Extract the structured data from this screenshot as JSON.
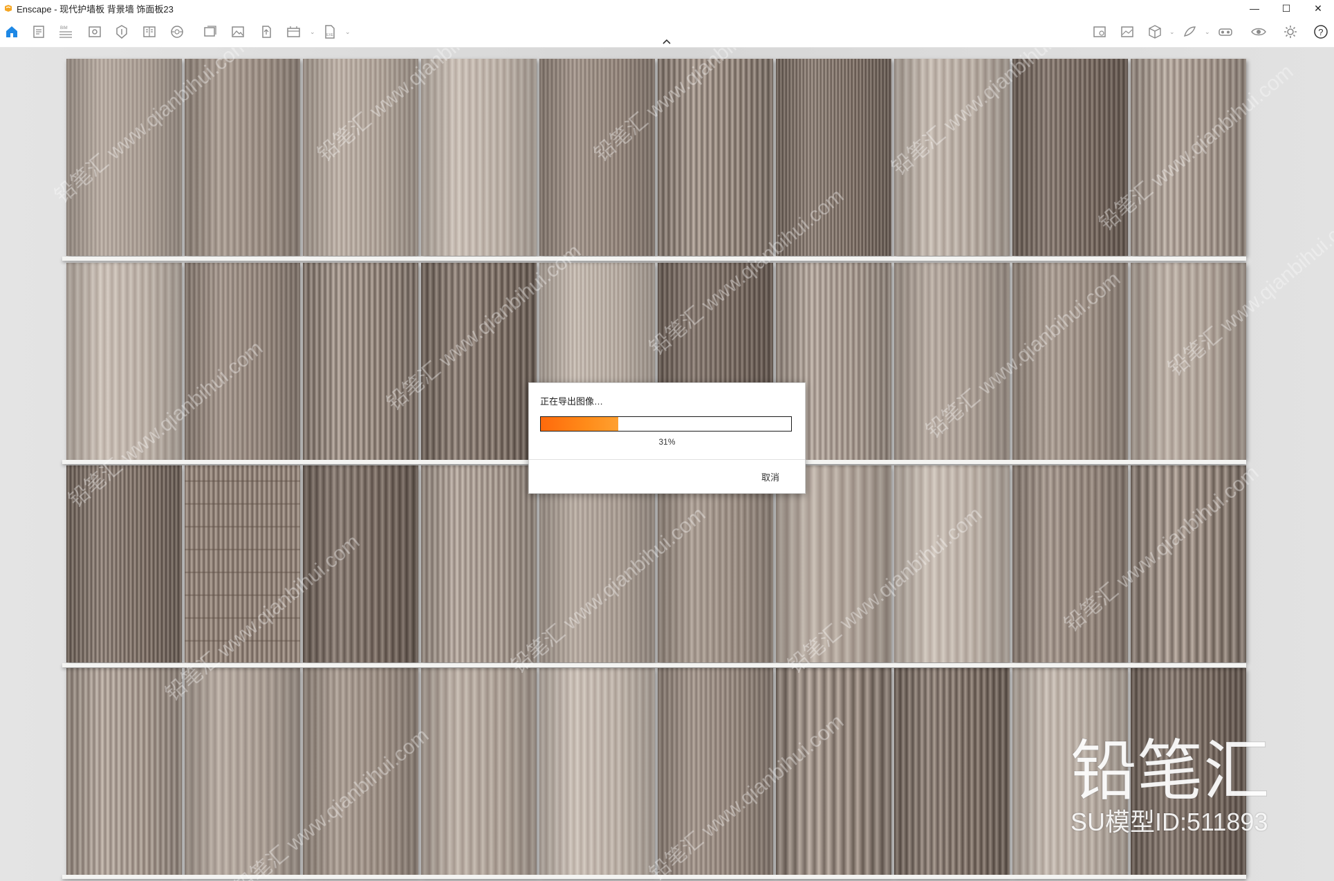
{
  "window": {
    "title": "Enscape - 现代护墙板 背景墙 饰面板23",
    "controls": {
      "minimize": "—",
      "maximize": "☐",
      "close": "✕"
    }
  },
  "toolbar": {
    "left_icons": [
      "home-icon",
      "document-icon",
      "bim-icon",
      "views-icon",
      "asset-library-icon",
      "split-view-icon",
      "panorama-icon",
      "batch-render-icon",
      "video-editor-icon",
      "image-icon",
      "upload-icon",
      "render-icon",
      "export-icon"
    ],
    "right_icons": [
      "settings-panel-icon",
      "visual-settings-icon",
      "cube-icon",
      "feedback-icon",
      "vr-icon",
      "eye-icon",
      "gear-icon",
      "help-icon"
    ]
  },
  "scene": {
    "watermark_text": "铅笔汇 www.qianbihui.com",
    "brand_logo": "铅笔汇",
    "model_id": "SU模型ID:511893"
  },
  "dialog": {
    "message": "正在导出图像…",
    "progress_percent": 31,
    "progress_text": "31%",
    "cancel_label": "取消"
  },
  "colors": {
    "accent": "#1e88e5",
    "progress": "#ff7a14"
  }
}
